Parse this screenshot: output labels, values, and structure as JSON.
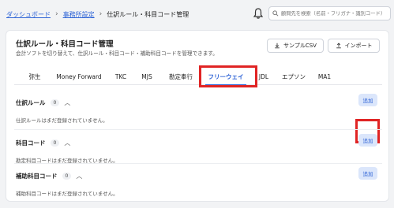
{
  "breadcrumb": {
    "items": [
      "ダッシュボード",
      "事務所設定",
      "仕訳ルール・科目コード管理"
    ],
    "separator": "›"
  },
  "search": {
    "placeholder": "顧問先を検索（名前・フリガナ・識別コード）"
  },
  "header": {
    "title": "仕訳ルール・科目コード管理",
    "subtitle": "会計ソフトを切り替えて、仕訳ルール・科目コード・補助科目コードを管理できます。",
    "sample_csv_label": "サンプルCSV",
    "import_label": "インポート"
  },
  "tabs": [
    {
      "label": "弥生",
      "active": false
    },
    {
      "label": "Money Forward",
      "active": false
    },
    {
      "label": "TKC",
      "active": false
    },
    {
      "label": "MJS",
      "active": false
    },
    {
      "label": "勘定奉行",
      "active": false
    },
    {
      "label": "フリーウェイ",
      "active": true
    },
    {
      "label": "JDL",
      "active": false
    },
    {
      "label": "エプソン",
      "active": false
    },
    {
      "label": "MA1",
      "active": false
    }
  ],
  "sections": [
    {
      "title": "仕訳ルール",
      "count": "0",
      "empty_text": "仕訳ルールはまだ登録されていません。",
      "add_label": "追加"
    },
    {
      "title": "科目コード",
      "count": "0",
      "empty_text": "勘定科目コードはまだ登録されていません。",
      "add_label": "追加"
    },
    {
      "title": "補助科目コード",
      "count": "0",
      "empty_text": "補助科目コードはまだ登録されていません。",
      "add_label": "追加"
    }
  ],
  "colors": {
    "accent": "#2f64d6",
    "highlight": "#e02424",
    "add_bg": "#dbe6fb"
  },
  "icons": [
    "bell-icon",
    "search-icon",
    "download-icon",
    "upload-icon",
    "chevron-up-icon"
  ]
}
